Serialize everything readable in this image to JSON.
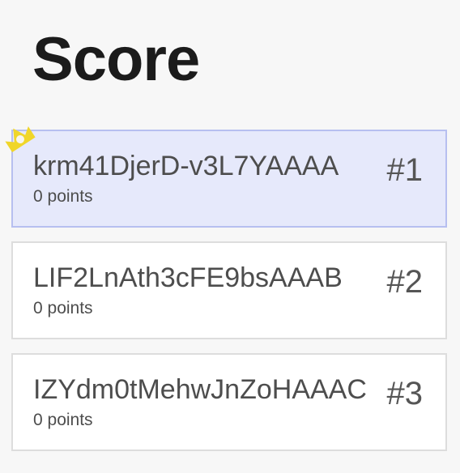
{
  "title": "Score",
  "players": [
    {
      "name": "krm41DjerD-v3L7YAAAA",
      "points": "0 points",
      "rank": "#1",
      "highlighted": true
    },
    {
      "name": "LIF2LnAth3cFE9bsAAAB",
      "points": "0 points",
      "rank": "#2",
      "highlighted": false
    },
    {
      "name": "IZYdm0tMehwJnZoHAAAC",
      "points": "0 points",
      "rank": "#3",
      "highlighted": false
    }
  ],
  "icons": {
    "leader_badge": "crown-icon"
  },
  "colors": {
    "background": "#f7f7f7",
    "highlight_fill": "#e6e9fb",
    "highlight_border": "#b7bff0",
    "crown": "#f0d62a"
  }
}
